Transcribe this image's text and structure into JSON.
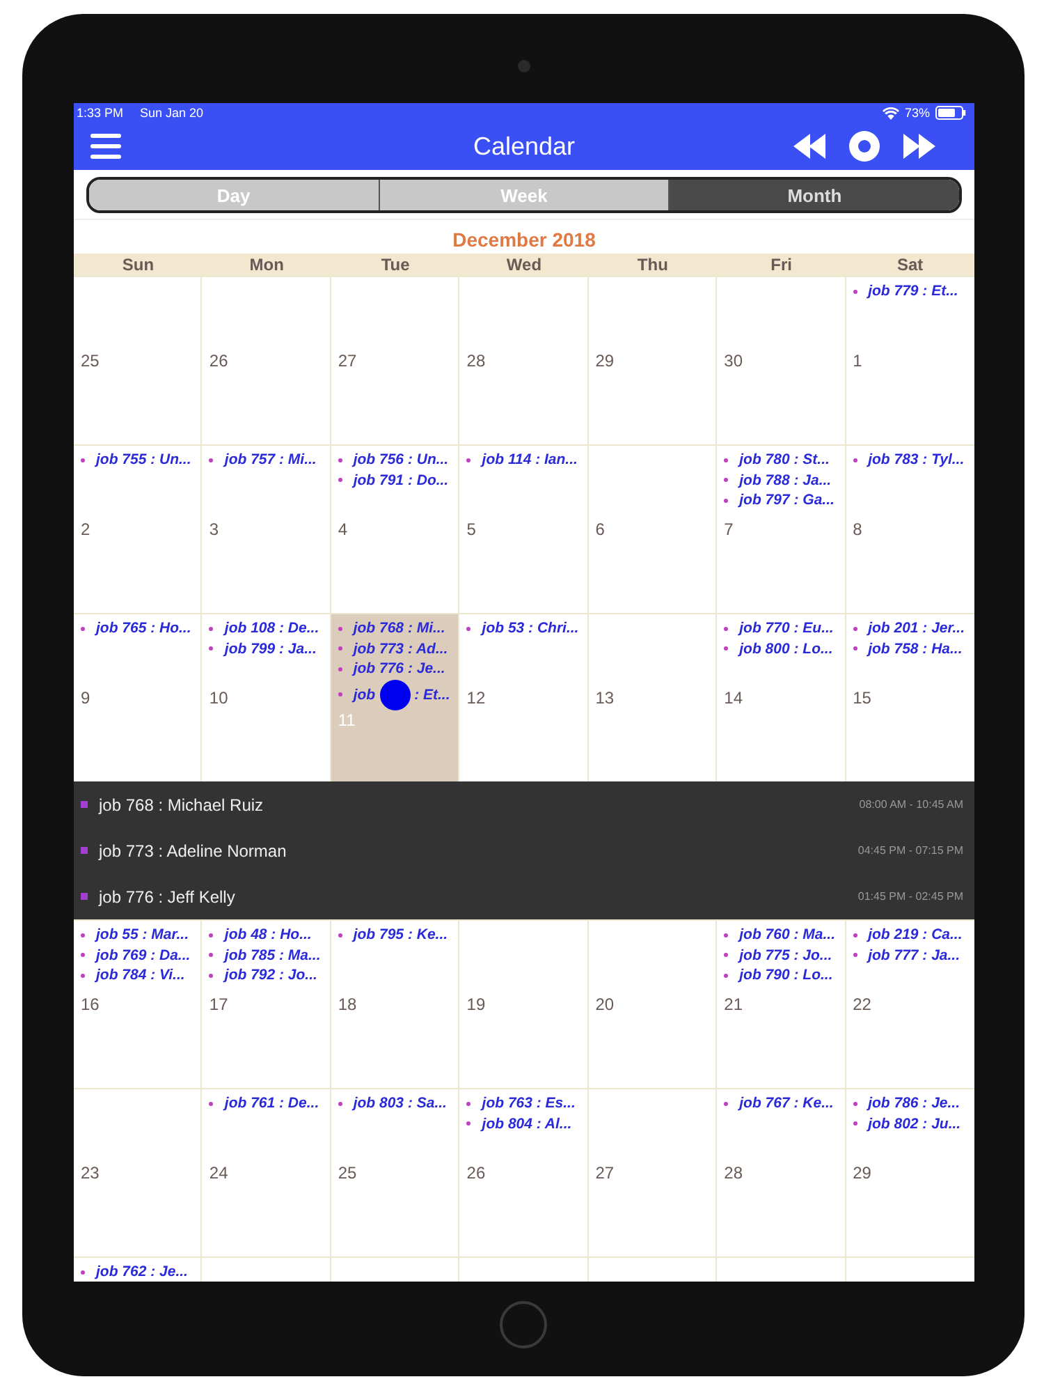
{
  "status_bar": {
    "time": "1:33 PM",
    "date": "Sun Jan 20",
    "battery": "73%"
  },
  "nav_bar": {
    "title": "Calendar"
  },
  "tabs": [
    {
      "label": "Day",
      "selected": false
    },
    {
      "label": "Week",
      "selected": false
    },
    {
      "label": "Month",
      "selected": true
    }
  ],
  "month_title": "December 2018",
  "weekdays": [
    "Sun",
    "Mon",
    "Tue",
    "Wed",
    "Thu",
    "Fri",
    "Sat"
  ],
  "weeks": [
    {
      "days": [
        {
          "number": "25",
          "selected": false
        },
        {
          "number": "26",
          "selected": false
        },
        {
          "number": "27",
          "selected": false
        },
        {
          "number": "28",
          "selected": false
        },
        {
          "number": "29",
          "selected": false
        },
        {
          "number": "30",
          "selected": false
        },
        {
          "number": "1",
          "selected": false,
          "events": [
            {
              "kind": "plain",
              "text": "job 779 : Et..."
            }
          ]
        }
      ]
    },
    {
      "days": [
        {
          "number": "2",
          "selected": false,
          "events": [
            {
              "kind": "plain",
              "text": "job 755 : Un..."
            }
          ]
        },
        {
          "number": "3",
          "selected": false,
          "events": [
            {
              "kind": "plain",
              "text": "job 757 : Mi..."
            }
          ]
        },
        {
          "number": "4",
          "selected": false,
          "events": [
            {
              "kind": "plain",
              "text": "job 756 : Un..."
            },
            {
              "kind": "plain",
              "text": "job 791 : Do..."
            }
          ]
        },
        {
          "number": "5",
          "selected": false,
          "events": [
            {
              "kind": "plain",
              "text": "job 114 : Ian..."
            }
          ]
        },
        {
          "number": "6",
          "selected": false
        },
        {
          "number": "7",
          "selected": false,
          "events": [
            {
              "kind": "plain",
              "text": "job 780 : St..."
            },
            {
              "kind": "plain",
              "text": "job 788 : Ja..."
            },
            {
              "kind": "plain",
              "text": "job 797 : Ga..."
            }
          ]
        },
        {
          "number": "8",
          "selected": false,
          "events": [
            {
              "kind": "plain",
              "text": "job 783 : Tyl..."
            }
          ]
        }
      ]
    },
    {
      "days": [
        {
          "number": "9",
          "selected": false,
          "events": [
            {
              "kind": "plain",
              "text": "job 765 : Ho..."
            }
          ]
        },
        {
          "number": "10",
          "selected": false,
          "events": [
            {
              "kind": "plain",
              "text": "job 108 : De..."
            },
            {
              "kind": "plain",
              "text": "job 799 : Ja..."
            }
          ]
        },
        {
          "number": "11",
          "selected": true,
          "events": [
            {
              "kind": "plain",
              "text": "job 768 : Mi..."
            },
            {
              "kind": "plain",
              "text": "job 773 : Ad..."
            },
            {
              "kind": "plain",
              "text": "job 776 : Je..."
            },
            {
              "kind": "covered",
              "text": "job",
              "after": ": Et..."
            }
          ]
        },
        {
          "number": "12",
          "selected": false,
          "events": [
            {
              "kind": "plain",
              "text": "job 53 : Chri..."
            }
          ]
        },
        {
          "number": "13",
          "selected": false
        },
        {
          "number": "14",
          "selected": false,
          "events": [
            {
              "kind": "plain",
              "text": "job 770 : Eu..."
            },
            {
              "kind": "plain",
              "text": "job 800 : Lo..."
            }
          ]
        },
        {
          "number": "15",
          "selected": false,
          "events": [
            {
              "kind": "plain",
              "text": "job 201 : Jer..."
            },
            {
              "kind": "plain",
              "text": "job 758 : Ha..."
            }
          ]
        }
      ],
      "details": [
        {
          "title": "job 768 : Michael Ruiz",
          "time": "08:00 AM - 10:45 AM",
          "color": "#a23fd0"
        },
        {
          "title": "job 773 : Adeline Norman",
          "time": "04:45 PM - 07:15 PM",
          "color": "#a23fd0"
        },
        {
          "title": "job 776 : Jeff Kelly",
          "time": "01:45 PM - 02:45 PM",
          "color": "#a23fd0"
        }
      ]
    },
    {
      "days": [
        {
          "number": "16",
          "selected": false,
          "events": [
            {
              "kind": "plain",
              "text": "job 55 : Mar..."
            },
            {
              "kind": "plain",
              "text": "job 769 : Da..."
            },
            {
              "kind": "plain",
              "text": "job 784 : Vi..."
            }
          ]
        },
        {
          "number": "17",
          "selected": false,
          "events": [
            {
              "kind": "plain",
              "text": "job 48 : Ho..."
            },
            {
              "kind": "plain",
              "text": "job 785 : Ma..."
            },
            {
              "kind": "plain",
              "text": "job 792 : Jo..."
            }
          ]
        },
        {
          "number": "18",
          "selected": false,
          "events": [
            {
              "kind": "plain",
              "text": "job 795 : Ke..."
            }
          ]
        },
        {
          "number": "19",
          "selected": false
        },
        {
          "number": "20",
          "selected": false
        },
        {
          "number": "21",
          "selected": false,
          "events": [
            {
              "kind": "plain",
              "text": "job 760 : Ma..."
            },
            {
              "kind": "plain",
              "text": "job 775 : Jo..."
            },
            {
              "kind": "plain",
              "text": "job 790 : Lo..."
            }
          ]
        },
        {
          "number": "22",
          "selected": false,
          "events": [
            {
              "kind": "plain",
              "text": "job 219 : Ca..."
            },
            {
              "kind": "plain",
              "text": "job 777 : Ja..."
            }
          ]
        }
      ]
    },
    {
      "days": [
        {
          "number": "23",
          "selected": false
        },
        {
          "number": "24",
          "selected": false,
          "events": [
            {
              "kind": "plain",
              "text": "job 761 : De..."
            }
          ]
        },
        {
          "number": "25",
          "selected": false,
          "events": [
            {
              "kind": "plain",
              "text": "job 803 : Sa..."
            }
          ]
        },
        {
          "number": "26",
          "selected": false,
          "events": [
            {
              "kind": "plain",
              "text": "job 763 : Es..."
            },
            {
              "kind": "plain",
              "text": "job 804 : Al..."
            }
          ]
        },
        {
          "number": "27",
          "selected": false
        },
        {
          "number": "28",
          "selected": false,
          "events": [
            {
              "kind": "plain",
              "text": "job 767 : Ke..."
            }
          ]
        },
        {
          "number": "29",
          "selected": false,
          "events": [
            {
              "kind": "plain",
              "text": "job 786 : Je..."
            },
            {
              "kind": "plain",
              "text": "job 802 : Ju..."
            }
          ]
        }
      ]
    },
    {
      "days": [
        {
          "events": [
            {
              "kind": "plain",
              "text": "job 762 : Je..."
            }
          ]
        }
      ]
    }
  ]
}
